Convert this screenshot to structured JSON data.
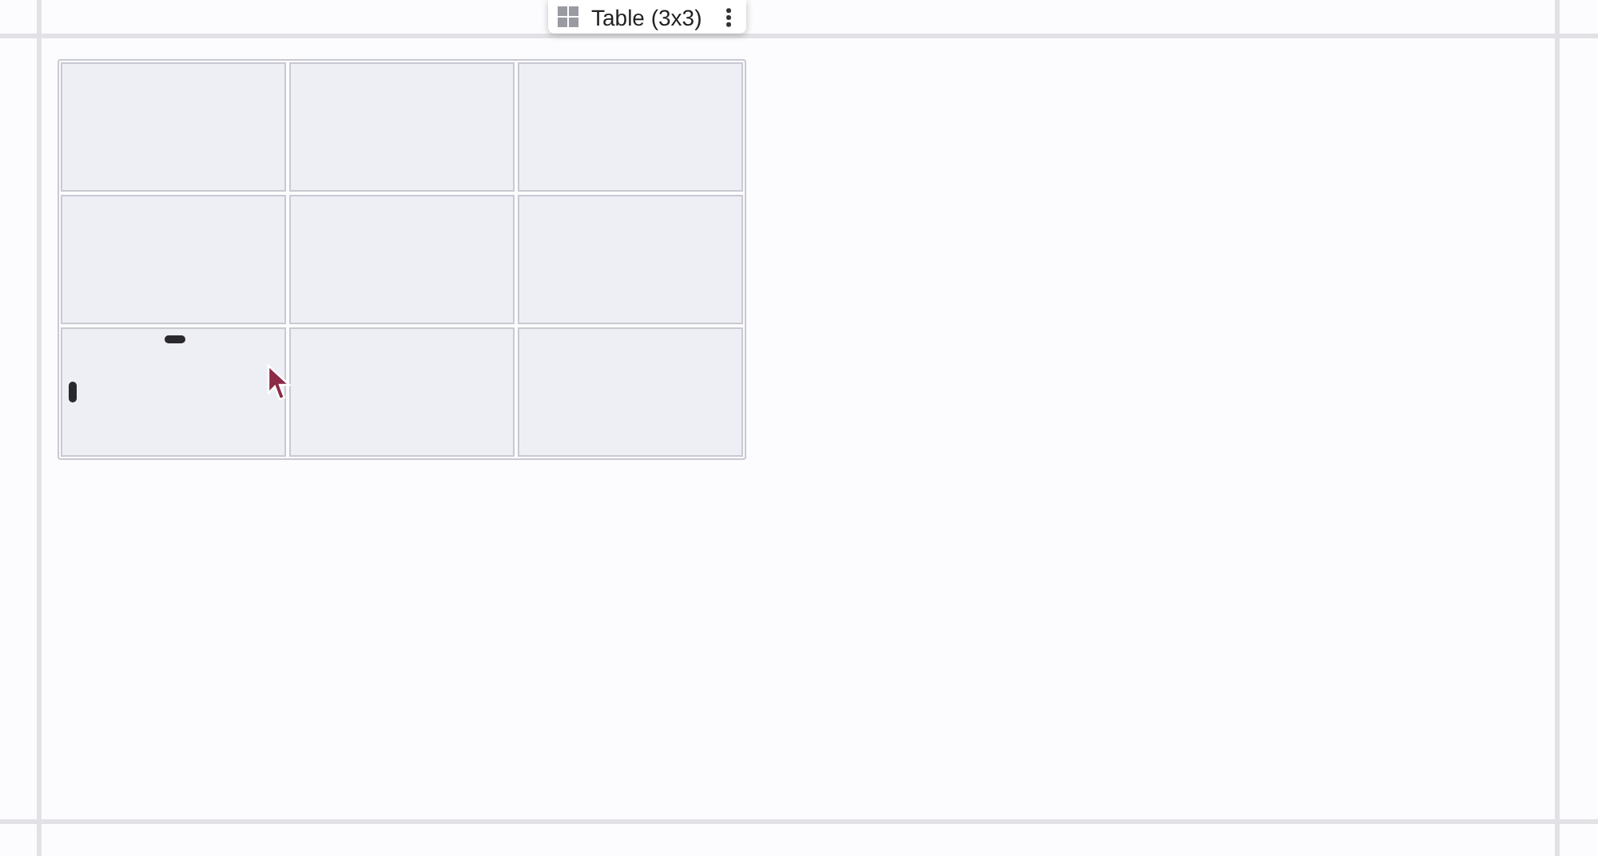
{
  "toolbar": {
    "label": "Table (3x3)"
  },
  "table": {
    "rows": [
      {
        "cells": [
          {
            "kind": "empty",
            "hovered": false
          },
          {
            "kind": "empty",
            "hovered": false
          },
          {
            "kind": "empty",
            "hovered": false
          }
        ]
      },
      {
        "cells": [
          {
            "kind": "empty",
            "hovered": false
          },
          {
            "kind": "empty",
            "hovered": false
          },
          {
            "kind": "empty",
            "hovered": false
          }
        ]
      },
      {
        "cells": [
          {
            "kind": "empty",
            "hovered": true
          },
          {
            "kind": "empty",
            "hovered": false
          },
          {
            "kind": "empty",
            "hovered": false
          }
        ]
      }
    ]
  }
}
